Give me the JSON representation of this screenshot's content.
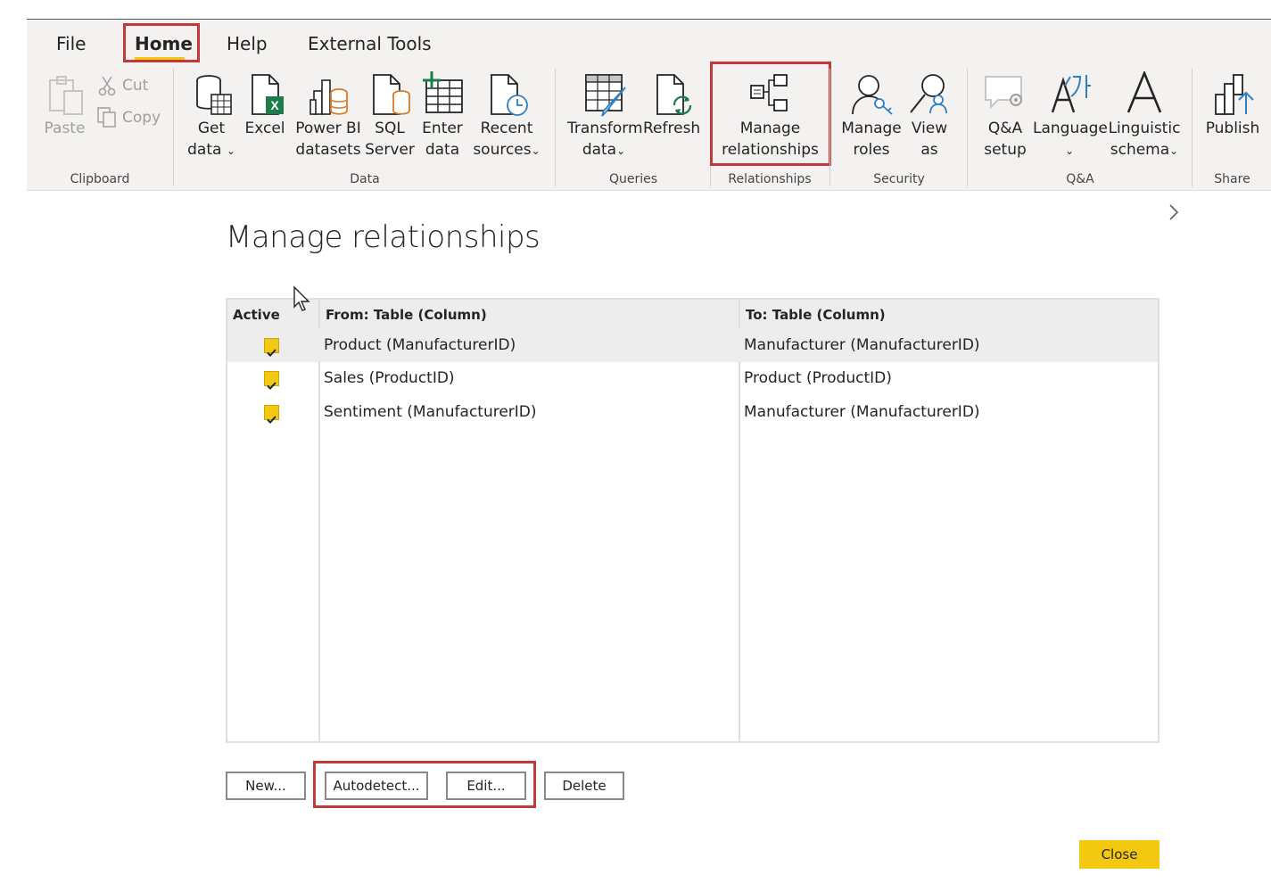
{
  "ribbon": {
    "tabs": [
      "File",
      "Home",
      "Help",
      "External Tools"
    ],
    "clipboard": {
      "paste": "Paste",
      "cut": "Cut",
      "copy": "Copy",
      "group": "Clipboard"
    },
    "data": {
      "get_data": [
        "Get",
        "data"
      ],
      "excel": "Excel",
      "power_bi": [
        "Power BI",
        "datasets"
      ],
      "sql": [
        "SQL",
        "Server"
      ],
      "enter": [
        "Enter",
        "data"
      ],
      "recent": [
        "Recent",
        "sources"
      ],
      "group": "Data"
    },
    "queries": {
      "transform": [
        "Transform",
        "data"
      ],
      "refresh": "Refresh",
      "group": "Queries"
    },
    "relationships": {
      "manage": [
        "Manage",
        "relationships"
      ],
      "group": "Relationships"
    },
    "security": {
      "manage_roles": [
        "Manage",
        "roles"
      ],
      "view_as": [
        "View",
        "as"
      ],
      "group": "Security"
    },
    "qa": {
      "setup": [
        "Q&A",
        "setup"
      ],
      "language": "Language",
      "linguistic": [
        "Linguistic",
        "schema"
      ],
      "group": "Q&A"
    },
    "share": {
      "publish": "Publish",
      "group": "Share"
    },
    "colors": {
      "highlight": "#c0393b",
      "accent": "#f2c811"
    }
  },
  "dialog": {
    "title": "Manage relationships",
    "columns": [
      "Active",
      "From: Table (Column)",
      "To: Table (Column)"
    ],
    "rows": [
      {
        "active": true,
        "from": "Product (ManufacturerID)",
        "to": "Manufacturer (ManufacturerID)"
      },
      {
        "active": true,
        "from": "Sales (ProductID)",
        "to": "Product (ProductID)"
      },
      {
        "active": true,
        "from": "Sentiment (ManufacturerID)",
        "to": "Manufacturer (ManufacturerID)"
      }
    ],
    "buttons": {
      "new": "New...",
      "autodetect": "Autodetect...",
      "edit": "Edit...",
      "delete": "Delete",
      "close": "Close"
    }
  }
}
